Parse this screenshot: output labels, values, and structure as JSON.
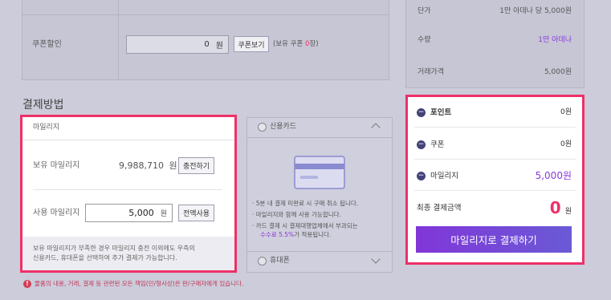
{
  "coupon": {
    "label": "쿠폰할인",
    "value": "0",
    "unit": "원",
    "button": "쿠폰보기",
    "held_prefix": "(보유 쿠폰 ",
    "held_count": "0",
    "held_suffix": "장)"
  },
  "payment": {
    "section_title": "결제방법",
    "mileage": {
      "tab": "마일리지",
      "held_label": "보유 마일리지",
      "held_value": "9,988,710",
      "held_unit": "원",
      "charge_button": "충전하기",
      "use_label": "사용 마일리지",
      "use_value": "5,000",
      "use_unit": "원",
      "use_all_button": "전액사용",
      "notice_line1": "보유 마일리지가 부족한 경우 마일리지 충전 이외에도 우측의",
      "notice_line2": "신용카드, 휴대폰을 선택하여 추가 결제가 가능합니다."
    },
    "credit_card": {
      "label": "신용카드",
      "bullet1": "· 5분 내 결제 미완료 시 구매 취소 됩니다.",
      "bullet2": "· 마일리지와 함께 사용 가능합니다.",
      "bullet3a": "· 카드 결제 시 결제대행업체에서 부과되는",
      "bullet3b_highlight": "수수료 5.5%",
      "bullet3b_rest": "가 적용됩니다."
    },
    "phone": {
      "label": "휴대폰"
    },
    "footer_notice": "물품의 내용, 거래, 결제 등 관련된 모든 책임(민/형사상)은 판/구매자에게 있습니다."
  },
  "summary": {
    "unit_price_label": "단가",
    "unit_price_value": "1만 아데나 당 5,000원",
    "quantity_label": "수량",
    "quantity_value": "1만 아데나",
    "trade_price_label": "거래가격",
    "trade_price_value": "5,000원",
    "points_label": "포인트",
    "points_value": "0원",
    "coupon_label": "쿠폰",
    "coupon_value": "0원",
    "mileage_label": "마일리지",
    "mileage_value": "5,000원",
    "final_label": "최종 결제금액",
    "final_value": "0",
    "final_unit": "원",
    "pay_button": "마일리지로 결제하기"
  },
  "colors": {
    "accent_pink": "#ee3068",
    "purple": "#8a3ad6",
    "pay_button": "#8136d8"
  }
}
